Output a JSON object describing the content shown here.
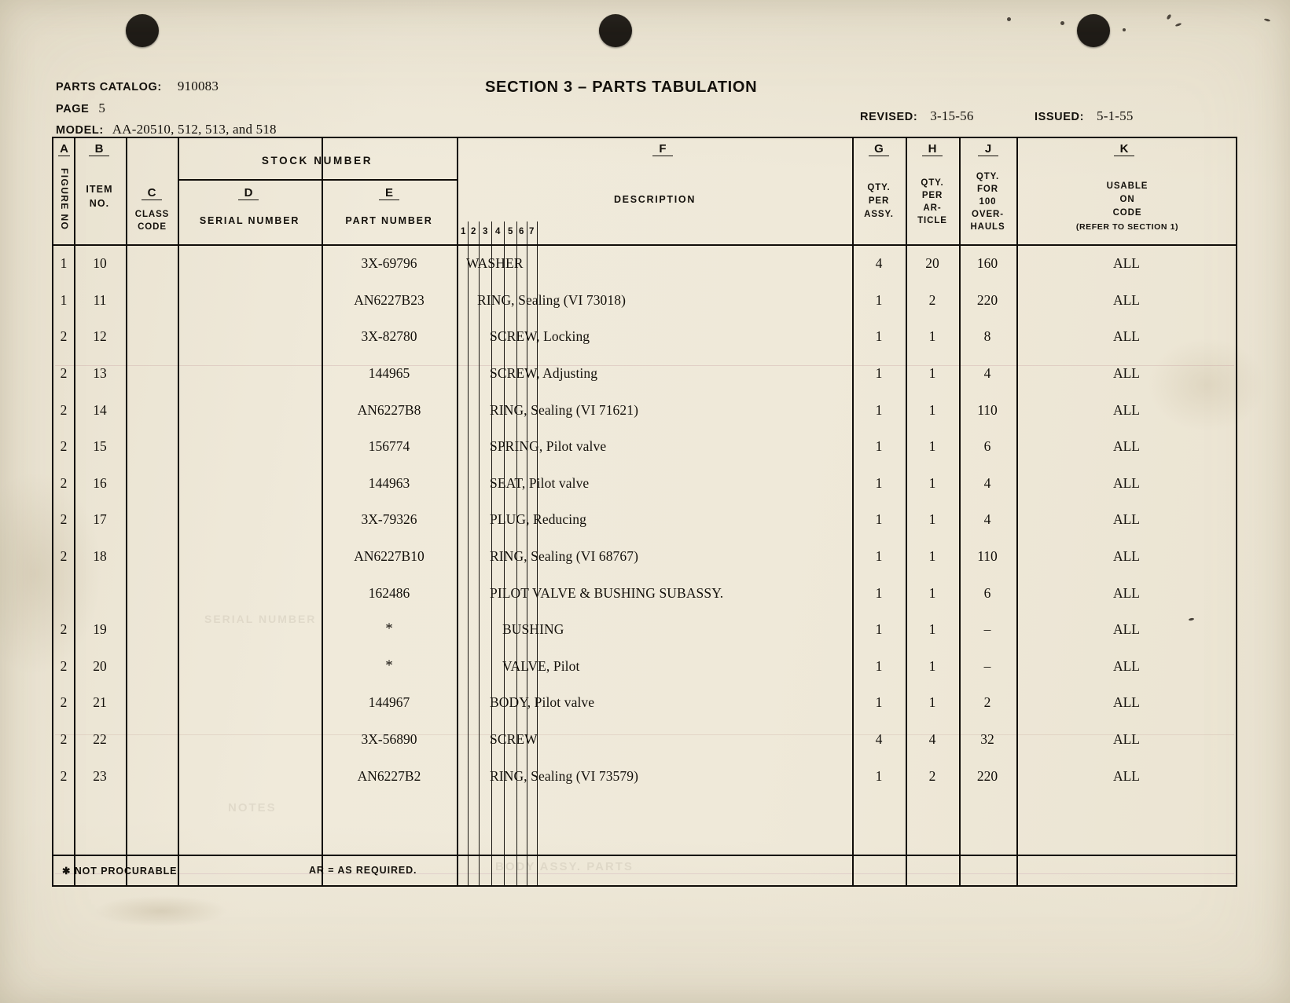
{
  "document": {
    "catalog_label": "PARTS CATALOG:",
    "catalog_value": "910083",
    "page_label": "PAGE",
    "page_value": "5",
    "model_label": "MODEL:",
    "model_value": "AA-20510, 512, 513, and 518",
    "section_title": "SECTION 3  –  PARTS TABULATION",
    "revised_label": "REVISED:",
    "revised_value": "3-15-56",
    "issued_label": "ISSUED:",
    "issued_value": "5-1-55"
  },
  "table": {
    "group_header": "STOCK NUMBER",
    "columns": [
      {
        "letter": "A",
        "name": "FIGURE NO.",
        "orientation": "vertical"
      },
      {
        "letter": "B",
        "name": "ITEM\nNO."
      },
      {
        "letter": "C",
        "name": "CLASS\nCODE"
      },
      {
        "letter": "D",
        "name": "SERIAL NUMBER"
      },
      {
        "letter": "E",
        "name": "PART NUMBER"
      },
      {
        "letter": "F",
        "name": "DESCRIPTION"
      },
      {
        "letter": "G",
        "name": "QTY.\nPER\nASSY."
      },
      {
        "letter": "H",
        "name": "QTY.\nPER\nAR-\nTICLE"
      },
      {
        "letter": "J",
        "name": "QTY.\nFOR\n100\nOVER-\nHAULS"
      },
      {
        "letter": "K",
        "name": "USABLE\nON\nCODE\n(REFER TO SECTION 1)"
      }
    ],
    "col_letters": {
      "a": "A",
      "b": "B",
      "c": "C",
      "d": "D",
      "e": "E",
      "f": "F",
      "g": "G",
      "h": "H",
      "j": "J",
      "k": "K"
    },
    "col_names": {
      "figure_no": "FIGURE NO",
      "item_no_1": "ITEM",
      "item_no_2": "NO.",
      "class_code_1": "CLASS",
      "class_code_2": "CODE",
      "serial_number": "SERIAL NUMBER",
      "part_number": "PART NUMBER",
      "stock_number": "STOCK NUMBER",
      "description": "DESCRIPTION",
      "g1": "QTY.",
      "g2": "PER",
      "g3": "ASSY.",
      "h1": "QTY.",
      "h2": "PER",
      "h3": "AR-",
      "h4": "TICLE",
      "j1": "QTY.",
      "j2": "FOR",
      "j3": "100",
      "j4": "OVER-",
      "j5": "HAULS",
      "k1": "USABLE",
      "k2": "ON",
      "k3": "CODE",
      "k4": "(REFER TO SECTION 1)"
    },
    "indent_ruler": [
      "1",
      "2",
      "3",
      "4",
      "5",
      "6",
      "7"
    ],
    "rows": [
      {
        "figure_no": "1",
        "item_no": "10",
        "class_code": "",
        "serial_number": "",
        "part_number": "3X-69796",
        "indent": 1,
        "description": "WASHER",
        "qty_per_assy": "4",
        "qty_per_article": "20",
        "qty_100_overhauls": "160",
        "usable_on_code": "ALL"
      },
      {
        "figure_no": "1",
        "item_no": "11",
        "class_code": "",
        "serial_number": "",
        "part_number": "AN6227B23",
        "indent": 2,
        "description": "RING, Sealing (VI 73018)",
        "qty_per_assy": "1",
        "qty_per_article": "2",
        "qty_100_overhauls": "220",
        "usable_on_code": "ALL"
      },
      {
        "figure_no": "2",
        "item_no": "12",
        "class_code": "",
        "serial_number": "",
        "part_number": "3X-82780",
        "indent": 3,
        "description": "SCREW, Locking",
        "qty_per_assy": "1",
        "qty_per_article": "1",
        "qty_100_overhauls": "8",
        "usable_on_code": "ALL"
      },
      {
        "figure_no": "2",
        "item_no": "13",
        "class_code": "",
        "serial_number": "",
        "part_number": "144965",
        "indent": 3,
        "description": "SCREW, Adjusting",
        "qty_per_assy": "1",
        "qty_per_article": "1",
        "qty_100_overhauls": "4",
        "usable_on_code": "ALL"
      },
      {
        "figure_no": "2",
        "item_no": "14",
        "class_code": "",
        "serial_number": "",
        "part_number": "AN6227B8",
        "indent": 3,
        "description": "RING, Sealing (VI 71621)",
        "qty_per_assy": "1",
        "qty_per_article": "1",
        "qty_100_overhauls": "110",
        "usable_on_code": "ALL"
      },
      {
        "figure_no": "2",
        "item_no": "15",
        "class_code": "",
        "serial_number": "",
        "part_number": "156774",
        "indent": 3,
        "description": "SPRING, Pilot valve",
        "qty_per_assy": "1",
        "qty_per_article": "1",
        "qty_100_overhauls": "6",
        "usable_on_code": "ALL"
      },
      {
        "figure_no": "2",
        "item_no": "16",
        "class_code": "",
        "serial_number": "",
        "part_number": "144963",
        "indent": 3,
        "description": "SEAT, Pilot valve",
        "qty_per_assy": "1",
        "qty_per_article": "1",
        "qty_100_overhauls": "4",
        "usable_on_code": "ALL"
      },
      {
        "figure_no": "2",
        "item_no": "17",
        "class_code": "",
        "serial_number": "",
        "part_number": "3X-79326",
        "indent": 3,
        "description": "PLUG, Reducing",
        "qty_per_assy": "1",
        "qty_per_article": "1",
        "qty_100_overhauls": "4",
        "usable_on_code": "ALL"
      },
      {
        "figure_no": "2",
        "item_no": "18",
        "class_code": "",
        "serial_number": "",
        "part_number": "AN6227B10",
        "indent": 3,
        "description": "RING, Sealing (VI 68767)",
        "qty_per_assy": "1",
        "qty_per_article": "1",
        "qty_100_overhauls": "110",
        "usable_on_code": "ALL"
      },
      {
        "figure_no": "",
        "item_no": "",
        "class_code": "",
        "serial_number": "",
        "part_number": "162486",
        "indent": 3,
        "description": "PILOT VALVE & BUSHING SUBASSY.",
        "qty_per_assy": "1",
        "qty_per_article": "1",
        "qty_100_overhauls": "6",
        "usable_on_code": "ALL"
      },
      {
        "figure_no": "2",
        "item_no": "19",
        "class_code": "",
        "serial_number": "",
        "part_number": "*",
        "indent": 4,
        "description": "BUSHING",
        "qty_per_assy": "1",
        "qty_per_article": "1",
        "qty_100_overhauls": "–",
        "usable_on_code": "ALL"
      },
      {
        "figure_no": "2",
        "item_no": "20",
        "class_code": "",
        "serial_number": "",
        "part_number": "*",
        "indent": 4,
        "description": "VALVE, Pilot",
        "qty_per_assy": "1",
        "qty_per_article": "1",
        "qty_100_overhauls": "–",
        "usable_on_code": "ALL"
      },
      {
        "figure_no": "2",
        "item_no": "21",
        "class_code": "",
        "serial_number": "",
        "part_number": "144967",
        "indent": 3,
        "description": "BODY, Pilot valve",
        "qty_per_assy": "1",
        "qty_per_article": "1",
        "qty_100_overhauls": "2",
        "usable_on_code": "ALL"
      },
      {
        "figure_no": "2",
        "item_no": "22",
        "class_code": "",
        "serial_number": "",
        "part_number": "3X-56890",
        "indent": 3,
        "description": "SCREW",
        "qty_per_assy": "4",
        "qty_per_article": "4",
        "qty_100_overhauls": "32",
        "usable_on_code": "ALL"
      },
      {
        "figure_no": "2",
        "item_no": "23",
        "class_code": "",
        "serial_number": "",
        "part_number": "AN6227B2",
        "indent": 3,
        "description": "RING, Sealing (VI 73579)",
        "qty_per_assy": "1",
        "qty_per_article": "2",
        "qty_100_overhauls": "220",
        "usable_on_code": "ALL"
      }
    ],
    "footnotes": {
      "not_procurable": "✱ NOT PROCURABLE.",
      "as_required": "AR = AS REQUIRED."
    }
  }
}
